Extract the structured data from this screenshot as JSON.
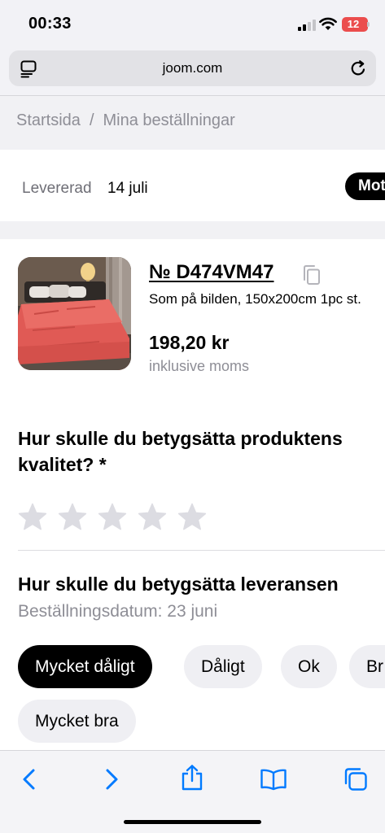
{
  "status_bar": {
    "time": "00:33",
    "battery": "12"
  },
  "browser": {
    "url": "joom.com"
  },
  "breadcrumb": {
    "home": "Startsida",
    "separator": "/",
    "current": "Mina beställningar"
  },
  "delivery": {
    "status_label": "Levererad",
    "date": "14 juli",
    "action_label": "Mott"
  },
  "product": {
    "order_number": "№ D474VM47",
    "description": "Som på bilden, 150x200cm 1pc st.",
    "price": "198,20 kr",
    "vat_note": "inklusive moms"
  },
  "quality_rating": {
    "question": "Hur skulle du betygsätta produktens kvalitet? *",
    "max_stars": 5,
    "value": 0
  },
  "delivery_rating": {
    "question": "Hur skulle du betygsätta leveransen",
    "order_date": "Beställningsdatum: 23 juni",
    "options": [
      "Mycket dåligt",
      "Dåligt",
      "Ok",
      "Br",
      "Mycket bra"
    ],
    "selected": "Mycket dåligt"
  },
  "colors": {
    "accent": "#007aff",
    "selected_chip": "#000000",
    "chip": "#efeff3",
    "muted_text": "#8e8e96",
    "battery_low": "#eb4d4d"
  },
  "toolbar": {
    "icons": [
      "back-icon",
      "forward-icon",
      "share-icon",
      "bookmarks-icon",
      "tabs-icon"
    ]
  }
}
